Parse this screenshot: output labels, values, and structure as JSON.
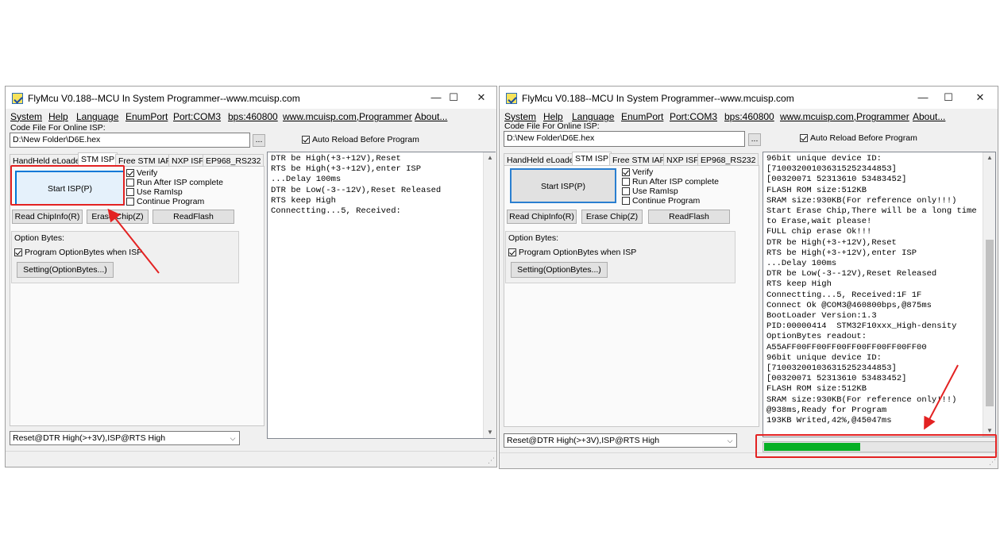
{
  "windows": [
    {
      "title": "FlyMcu V0.188--MCU In System Programmer--www.mcuisp.com",
      "controls": {
        "minimize": "—",
        "maximize": "☐",
        "close": "✕"
      },
      "menu": [
        "System",
        "Help",
        "Language",
        "EnumPort",
        "Port:COM3",
        "bps:460800",
        "www.mcuisp.com,Programmer",
        "About..."
      ],
      "code_file_label": "Code File For Online ISP:",
      "code_file_path": "D:\\New Folder\\D6E.hex",
      "browse_label": "...",
      "auto_reload_label": "Auto Reload Before Program",
      "tabs": [
        "HandHeld eLoader",
        "STM ISP",
        "Free STM IAP",
        "NXP ISP",
        "EP968_RS232"
      ],
      "start_isp_label": "Start ISP(P)",
      "checkboxes": [
        {
          "label": "Verify",
          "checked": true
        },
        {
          "label": "Run After ISP complete",
          "checked": false
        },
        {
          "label": "Use RamIsp",
          "checked": false
        },
        {
          "label": "Continue Program",
          "checked": false
        }
      ],
      "read_chipinfo_label": "Read ChipInfo(R)",
      "erase_chip_label": "Erase Chip(Z)",
      "read_flash_label": "ReadFlash",
      "option_bytes_label": "Option Bytes:",
      "program_option_bytes_label": "Program OptionBytes when ISP",
      "setting_option_bytes_label": "Setting(OptionBytes...)",
      "reset_mode": "Reset@DTR High(>+3V),ISP@RTS High",
      "log_lines": [
        "DTR be High(+3-+12V),Reset",
        "RTS be High(+3-+12V),enter ISP",
        "...Delay 100ms",
        "DTR be Low(-3--12V),Reset Released",
        "RTS keep High",
        "Connectting...5, Received:"
      ],
      "progress": 0
    },
    {
      "title": "FlyMcu V0.188--MCU In System Programmer--www.mcuisp.com",
      "controls": {
        "minimize": "—",
        "maximize": "☐",
        "close": "✕"
      },
      "menu": [
        "System",
        "Help",
        "Language",
        "EnumPort",
        "Port:COM3",
        "bps:460800",
        "www.mcuisp.com,Programmer",
        "About..."
      ],
      "code_file_label": "Code File For Online ISP:",
      "code_file_path": "D:\\New Folder\\D6E.hex",
      "browse_label": "...",
      "auto_reload_label": "Auto Reload Before Program",
      "tabs": [
        "HandHeld eLoader",
        "STM ISP",
        "Free STM IAP",
        "NXP ISP",
        "EP968_RS232"
      ],
      "start_isp_label": "Start ISP(P)",
      "checkboxes": [
        {
          "label": "Verify",
          "checked": true
        },
        {
          "label": "Run After ISP complete",
          "checked": false
        },
        {
          "label": "Use RamIsp",
          "checked": false
        },
        {
          "label": "Continue Program",
          "checked": false
        }
      ],
      "read_chipinfo_label": "Read ChipInfo(R)",
      "erase_chip_label": "Erase Chip(Z)",
      "read_flash_label": "ReadFlash",
      "option_bytes_label": "Option Bytes:",
      "program_option_bytes_label": "Program OptionBytes when ISP",
      "setting_option_bytes_label": "Setting(OptionBytes...)",
      "reset_mode": "Reset@DTR High(>+3V),ISP@RTS High",
      "log_lines": [
        "96bit unique device ID:",
        "[71003200103631525234485З]",
        "[00320071 52313610 53483452]",
        "FLASH ROM size:512KB",
        "SRAM size:930KB(For reference only!!!)",
        "Start Erase Chip,There will be a long time",
        "to Erase,wait please!",
        "FULL chip erase Ok!!!",
        "DTR be High(+3-+12V),Reset",
        "RTS be High(+3-+12V),enter ISP",
        "...Delay 100ms",
        "DTR be Low(-3--12V),Reset Released",
        "RTS keep High",
        "Connectting...5, Received:1F 1F",
        "Connect Ok @COM3@460800bps,@875ms",
        "BootLoader Version:1.3",
        "PID:00000414  STM32F10xxx_High-density",
        "OptionBytes readout:",
        "A55AFF00FF00FF00FF00FF00FF00FF00",
        "96bit unique device ID:",
        "[710032001036315252344853]",
        "[00320071 52313610 53483452]",
        "FLASH ROM size:512KB",
        "SRAM size:930KB(For reference only!!!)",
        "@938ms,Ready for Program",
        "193KB Writed,42%,@45047ms"
      ],
      "progress": 0.42
    }
  ],
  "colors": {
    "highlight": "#e32222",
    "progress": "#06b025"
  }
}
